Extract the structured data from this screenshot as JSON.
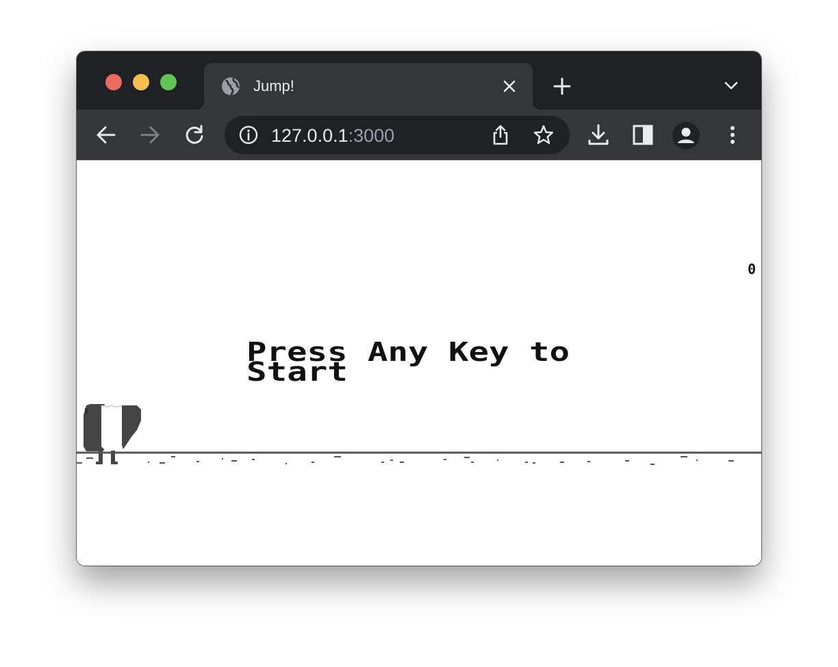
{
  "window": {
    "traffic_lights": {
      "close": "#ed6a5e",
      "minimize": "#f5bf4f",
      "zoom": "#61c554"
    }
  },
  "tab": {
    "title": "Jump!",
    "favicon": "globe-icon",
    "close_icon": "close-icon"
  },
  "toolbar": {
    "back_icon": "arrow-left-icon",
    "forward_icon": "arrow-right-icon",
    "reload_icon": "reload-icon",
    "site_info_icon": "info-icon",
    "url_host": "127.0.0.1",
    "url_port": ":3000",
    "share_icon": "share-icon",
    "bookmark_icon": "star-icon",
    "download_icon": "download-icon",
    "side_panel_icon": "side-panel-icon",
    "profile_icon": "profile-icon",
    "menu_icon": "more-vert-icon"
  },
  "game": {
    "score": "0",
    "prompt_line1": "Press Any Key to",
    "prompt_line2": "Start"
  },
  "colors": {
    "titlebar": "#202124",
    "toolbar": "#35363a",
    "omnibox": "#202124",
    "ground": "#535353",
    "character": "#454545"
  }
}
